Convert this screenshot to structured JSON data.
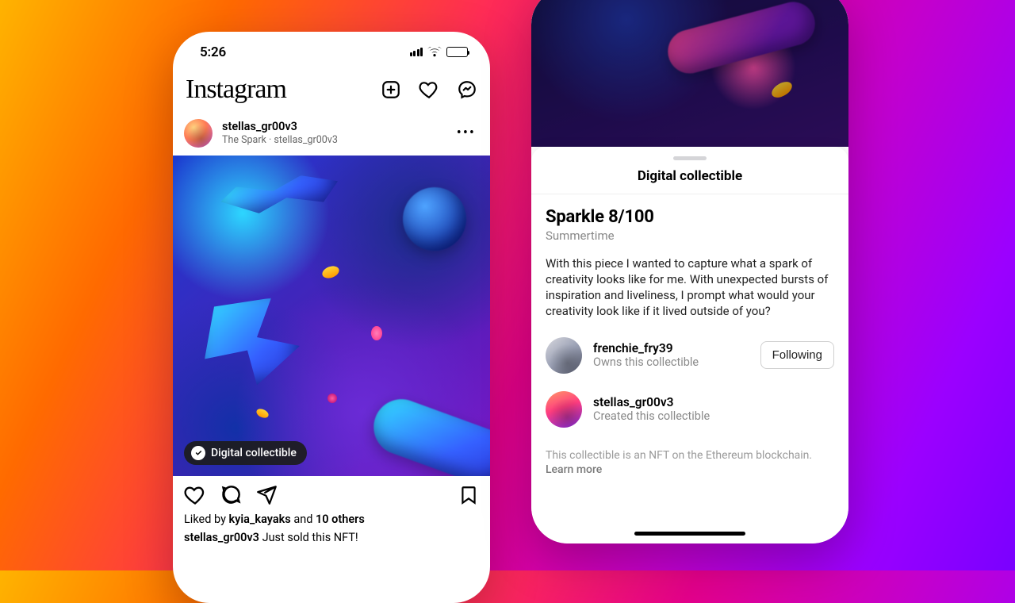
{
  "status": {
    "time": "5:26"
  },
  "ig": {
    "logo": "Instagram"
  },
  "post": {
    "username": "stellas_gr00v3",
    "subtext": "The Spark · stellas_gr00v3",
    "badge": "Digital collectible",
    "likes_prefix": "Liked by ",
    "likes_user": "kyia_kayaks",
    "likes_mid": " and ",
    "likes_count": "10 others",
    "caption_user": "stellas_gr00v3",
    "caption_text": " Just sold this NFT!"
  },
  "sheet": {
    "title": "Digital collectible",
    "nft_title": "Sparkle 8/100",
    "nft_subtitle": "Summertime",
    "description": "With this piece I wanted to capture what a spark of creativity looks like for me. With unexpected bursts of inspiration and liveliness, I prompt what would your creativity look like if it lived outside of you?",
    "owner": {
      "name": "frenchie_fry39",
      "sub": "Owns this collectible"
    },
    "creator": {
      "name": "stellas_gr00v3",
      "sub": "Created this collectible"
    },
    "follow_label": "Following",
    "disclaimer_text": "This collectible is an NFT on the Ethereum blockchain. ",
    "learn_more": "Learn more"
  }
}
